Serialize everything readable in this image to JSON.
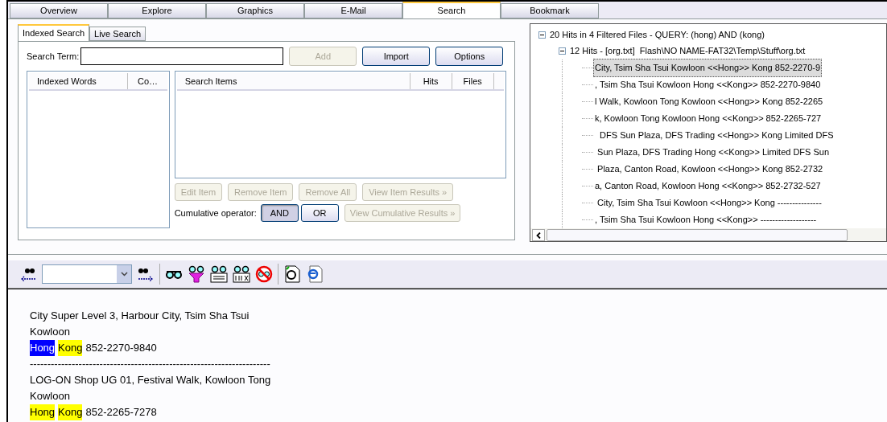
{
  "tabs": [
    {
      "label": "Overview",
      "selected": false
    },
    {
      "label": "Explore",
      "selected": false
    },
    {
      "label": "Graphics",
      "selected": false
    },
    {
      "label": "E-Mail",
      "selected": false
    },
    {
      "label": "Search",
      "selected": true
    },
    {
      "label": "Bookmark",
      "selected": false
    }
  ],
  "subtabs": [
    {
      "label": "Indexed Search",
      "selected": true
    },
    {
      "label": "Live Search",
      "selected": false
    }
  ],
  "search_term": {
    "label": "Search Term:"
  },
  "buttons_top": [
    {
      "label": "Add",
      "disabled": true
    },
    {
      "label": "Import",
      "disabled": false
    },
    {
      "label": "Options",
      "disabled": false
    }
  ],
  "indexed_columns": [
    "Indexed Words",
    "Co…"
  ],
  "items_columns": [
    "Search Items",
    "Hits",
    "Files"
  ],
  "item_buttons": [
    {
      "label": "Edit Item",
      "disabled": true
    },
    {
      "label": "Remove Item",
      "disabled": true
    },
    {
      "label": "Remove All",
      "disabled": true
    },
    {
      "label": "View Item Results »",
      "disabled": true
    }
  ],
  "operator": {
    "label": "Cumulative operator:",
    "options": [
      {
        "label": "AND",
        "selected": true
      },
      {
        "label": "OR",
        "selected": false
      }
    ],
    "view": {
      "label": "View Cumulative Results »",
      "disabled": true
    }
  },
  "tree": {
    "label": "20 Hits in 4 Filtered Files - QUERY: (hong) AND (kong)",
    "expanded": true,
    "children": [
      {
        "label": "12 Hits - [org.txt]  Flash\\NO NAME-FAT32\\Temp\\Stuff\\org.txt",
        "expanded": true,
        "children": [
          {
            "label": "City, Tsim Sha Tsui Kowloon <<Hong>> Kong 852-2270-9",
            "selected": true
          },
          {
            "label": ", Tsim Sha Tsui Kowloon Hong <<Kong>> 852-2270-9840",
            "selected": false
          },
          {
            "label": "l Walk, Kowloon Tong Kowloon <<Hong>> Kong 852-2265",
            "selected": false
          },
          {
            "label": "k, Kowloon Tong Kowloon Hong <<Kong>> 852-2265-727",
            "selected": false
          },
          {
            "label": "  DFS Sun Plaza, DFS Trading <<Hong>> Kong Limited DFS",
            "selected": false
          },
          {
            "label": " Sun Plaza, DFS Trading Hong <<Kong>> Limited DFS Sun",
            "selected": false
          },
          {
            "label": " Plaza, Canton Road, Kowloon <<Hong>> Kong 852-2732",
            "selected": false
          },
          {
            "label": "a, Canton Road, Kowloon Hong <<Kong>> 852-2732-527",
            "selected": false
          },
          {
            "label": " City, Tsim Sha Tsui Kowloon <<Hong>> Kong ---------------",
            "selected": false
          },
          {
            "label": ", Tsim Sha Tsui Kowloon Hong <<Kong>> -------------------",
            "selected": false
          }
        ]
      }
    ]
  },
  "preview": [
    {
      "segments": [
        {
          "text": "City Super Level 3, Harbour City, Tsim Sha Tsui",
          "marked": false,
          "current": false
        }
      ]
    },
    {
      "segments": [
        {
          "text": "Kowloon",
          "marked": false,
          "current": false
        }
      ]
    },
    {
      "segments": [
        {
          "text": "Hong",
          "marked": true,
          "current": true
        },
        {
          "text": "Kong",
          "marked": true,
          "current": false
        },
        {
          "text": "852-2270-9840",
          "marked": false,
          "current": false
        }
      ]
    },
    {
      "segments": [
        {
          "text": "---------------------------------------------------------------------",
          "marked": false,
          "current": false
        }
      ]
    },
    {
      "segments": [
        {
          "text": "LOG-ON Shop UG 01, Festival Walk, Kowloon Tong",
          "marked": false,
          "current": false
        }
      ]
    },
    {
      "segments": [
        {
          "text": "Kowloon",
          "marked": false,
          "current": false
        }
      ]
    },
    {
      "segments": [
        {
          "text": "Hong",
          "marked": true,
          "current": false
        },
        {
          "text": "Kong",
          "marked": true,
          "current": false
        },
        {
          "text": "852-2265-7278",
          "marked": false,
          "current": false
        }
      ]
    }
  ]
}
